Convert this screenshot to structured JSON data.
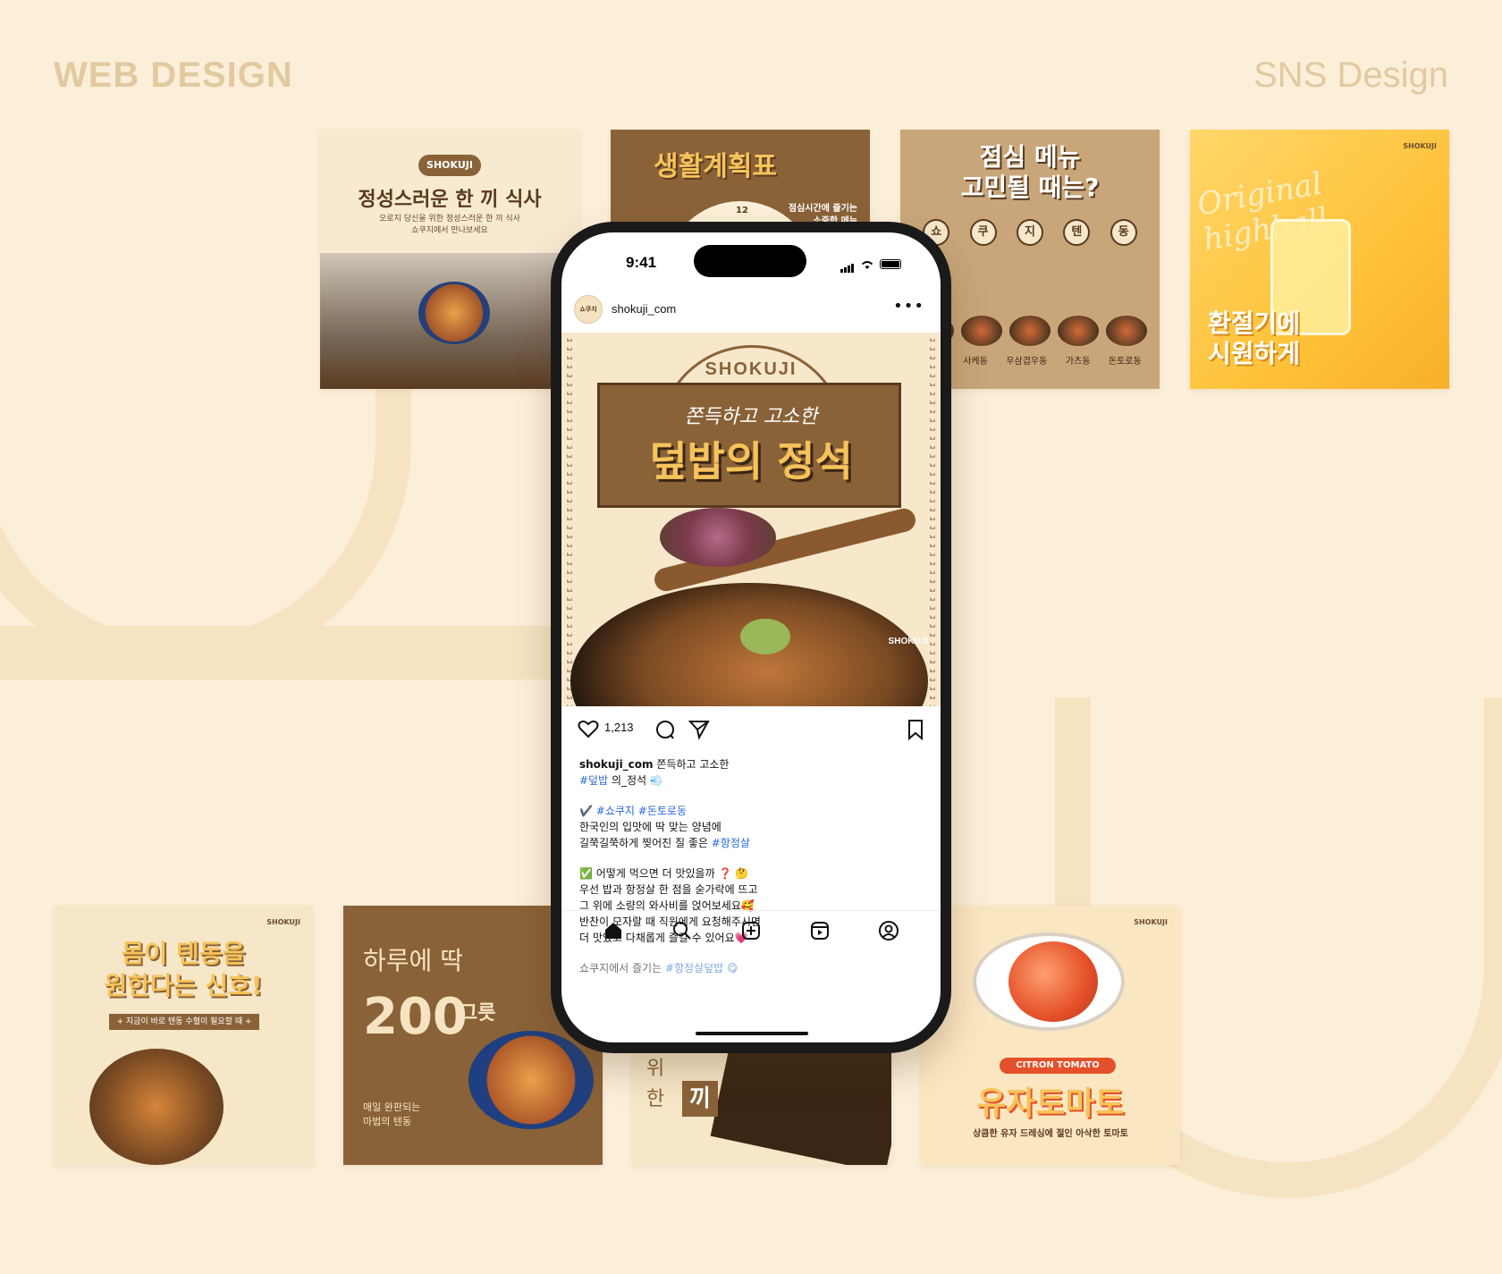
{
  "headings": {
    "left": "WEB DESIGN",
    "right": "SNS Design"
  },
  "tiles_top": [
    {
      "badge": "SHOKUJI",
      "title": "정성스러운 한 끼 식사",
      "sub1": "오로지 당신을 위한 정성스러운 한 끼 식사",
      "sub2": "쇼쿠지에서 만나보세요"
    },
    {
      "title": "생활계획표",
      "note1": "점심시간에 즐기는",
      "note2": "소중한 메뉴",
      "clock_number": "12"
    },
    {
      "title1": "점심 메뉴",
      "title2": "고민될 때는?",
      "menu": [
        "쇼",
        "쿠",
        "지",
        "텐",
        "동"
      ],
      "dishes": [
        "사케동",
        "우삼겹우동",
        "가츠동",
        "돈토로동"
      ]
    },
    {
      "script": "Original highball",
      "title1": "환절기에",
      "title2": "시원하게",
      "logo": "SHOKUJI"
    }
  ],
  "tiles_bottom": [
    {
      "title1": "몸이 텐동을",
      "title2": "원한다는 신호!",
      "strip": "+ 지금이 바로 텐동 수혈이 필요할 때 +",
      "logo": "SHOKUJI"
    },
    {
      "small": "하루에 딱",
      "big": "200",
      "unit": "그릇",
      "foot1": "매일 완판되는",
      "foot2": "마법의 텐동"
    },
    {
      "side1": "위",
      "side2": "한",
      "stamp": "끼"
    },
    {
      "pill": "CITRON TOMATO",
      "title": "유자토마토",
      "sub": "상큼한 유자 드레싱에 절인 아삭한 토마토",
      "logo": "SHOKUJI"
    }
  ],
  "phone": {
    "time": "9:41",
    "avatar_text": "쇼쿠지",
    "username": "shokuji_com",
    "post": {
      "brand": "SHOKUJI",
      "script": "쫀득하고 고소한",
      "title": "덮밥의 정석",
      "logo": "SHOKUJI"
    },
    "likes": "1,213",
    "caption": {
      "l1_user": "shokuji_com",
      "l1_text": " 쫀득하고 고소한",
      "l2_tag": "#덮밥",
      "l2_text": " 의_정석 💨",
      "l3_check": "✔️ ",
      "l3_tag1": "#쇼쿠지",
      "l3_tag2": " #돈토로동",
      "l4": "한국인의 입맛에 딱 맞는 양념에",
      "l5_text": "길쭉길쭉하게 찢어진 질 좋은 ",
      "l5_tag": "#항정살",
      "l6": "✅ 어떻게 먹으면 더 맛있을까 ❓ 🤔",
      "l7": "우선 밥과 항정살 한 점을 숟가락에 뜨고",
      "l8": "그 위에 소량의 와사비를 얹어보세요🥰",
      "l9": "반찬이 모자랄 때 직원에게 요청해주시면",
      "l10": "더 맛있고 다채롭게 즐길 수 있어요💗",
      "l11_text": "쇼쿠지에서 즐기는 ",
      "l11_tag": "#항정살덮밥 😋"
    }
  }
}
